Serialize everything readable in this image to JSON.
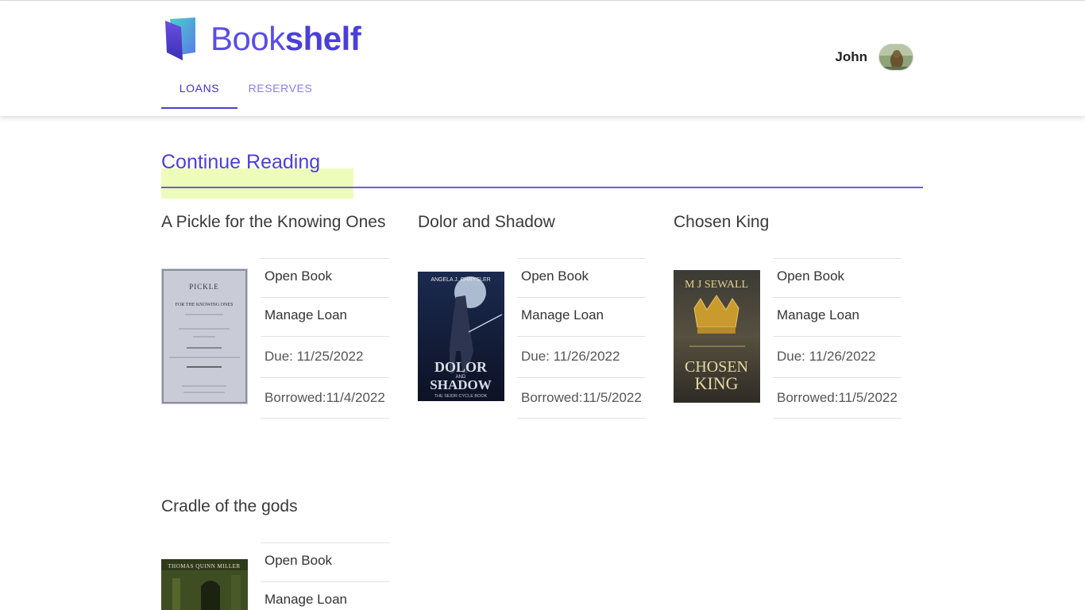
{
  "app": {
    "brand_light": "Book",
    "brand_bold": "shelf",
    "accent_color": "#4b3fd9"
  },
  "nav": {
    "tabs": [
      {
        "label": "LOANS",
        "active": true
      },
      {
        "label": "RESERVES",
        "active": false
      }
    ]
  },
  "user": {
    "name": "John",
    "avatar_icon": "user-avatar-photo"
  },
  "section": {
    "title": "Continue Reading"
  },
  "books": [
    {
      "title": "A Pickle for the Knowing Ones",
      "open_label": "Open Book",
      "manage_label": "Manage Loan",
      "due": "Due: 11/25/2022",
      "borrowed": "Borrowed:11/4/2022",
      "cover_text": [
        "PICKLE",
        "FOR THE KNOWING ONES"
      ]
    },
    {
      "title": "Dolor and Shadow",
      "open_label": "Open Book",
      "manage_label": "Manage Loan",
      "due": "Due: 11/26/2022",
      "borrowed": "Borrowed:11/5/2022",
      "cover_text": [
        "ANGELA J. CHRYSLER",
        "DOLOR",
        "AND",
        "SHADOW",
        "THE SEIDR CYCLE BOOK"
      ]
    },
    {
      "title": "Chosen King",
      "open_label": "Open Book",
      "manage_label": "Manage Loan",
      "due": "Due: 11/26/2022",
      "borrowed": "Borrowed:11/5/2022",
      "cover_text": [
        "M J SEWALL",
        "CHOSEN",
        "KING"
      ]
    },
    {
      "title": "Cradle of the gods",
      "open_label": "Open Book",
      "manage_label": "Manage Loan",
      "cover_text": [
        "THOMAS QUINN MILLER"
      ]
    }
  ]
}
